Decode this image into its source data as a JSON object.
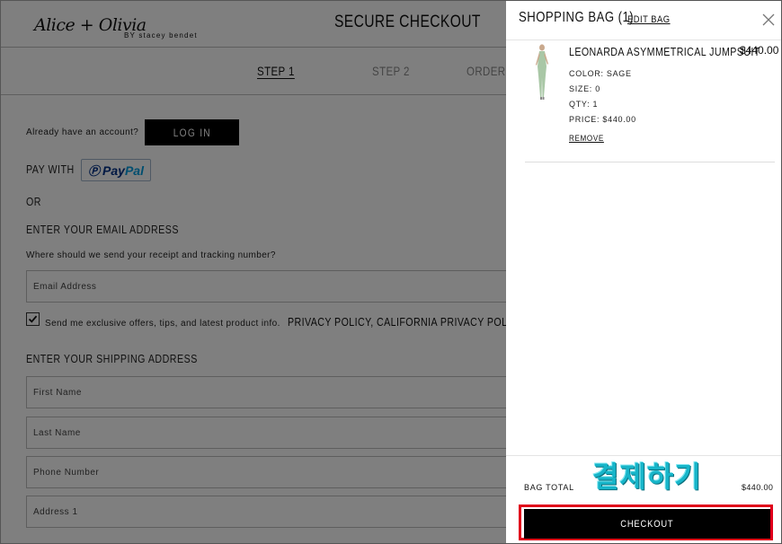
{
  "header": {
    "logo_script": "Alice + Olivia",
    "logo_by": "BY stacey bendet",
    "title": "SECURE CHECKOUT"
  },
  "steps": [
    "STEP 1",
    "STEP 2",
    "ORDER CO"
  ],
  "account": {
    "prompt": "Already have an account?",
    "login_label": "LOG IN"
  },
  "pay": {
    "label": "PAY WITH",
    "paypal_a": "Pay",
    "paypal_b": "Pal",
    "or": "OR"
  },
  "email": {
    "heading": "ENTER YOUR EMAIL ADDRESS",
    "subtext": "Where should we send your receipt and tracking number?",
    "placeholder": "Email Address",
    "optin_text": "Send me exclusive offers, tips, and latest product info.",
    "policy_text": "PRIVACY POLICY, CALIFORNIA PRIVACY POLICY",
    "optin_checked": true
  },
  "shipping": {
    "heading": "ENTER YOUR SHIPPING ADDRESS",
    "fields": [
      "First Name",
      "Last Name",
      "Phone Number",
      "Address 1"
    ]
  },
  "bag": {
    "title": "SHOPPING BAG (1)",
    "edit_label": "EDIT BAG",
    "item": {
      "name": "LEONARDA ASYMMETRICAL JUMPSUIT",
      "price": "$440.00",
      "color": "COLOR: SAGE",
      "size": "SIZE: 0",
      "qty": "QTY: 1",
      "unit_price": "PRICE: $440.00",
      "remove_label": "REMOVE"
    },
    "total_label": "BAG TOTAL",
    "total_value": "$440.00",
    "annotation": "결제하기",
    "checkout_label": "CHECKOUT"
  },
  "colors": {
    "accent": "#000000",
    "annotation": "#17b5c9",
    "highlight": "#e0001a",
    "paypal_dark": "#003087",
    "paypal_light": "#009cde"
  }
}
